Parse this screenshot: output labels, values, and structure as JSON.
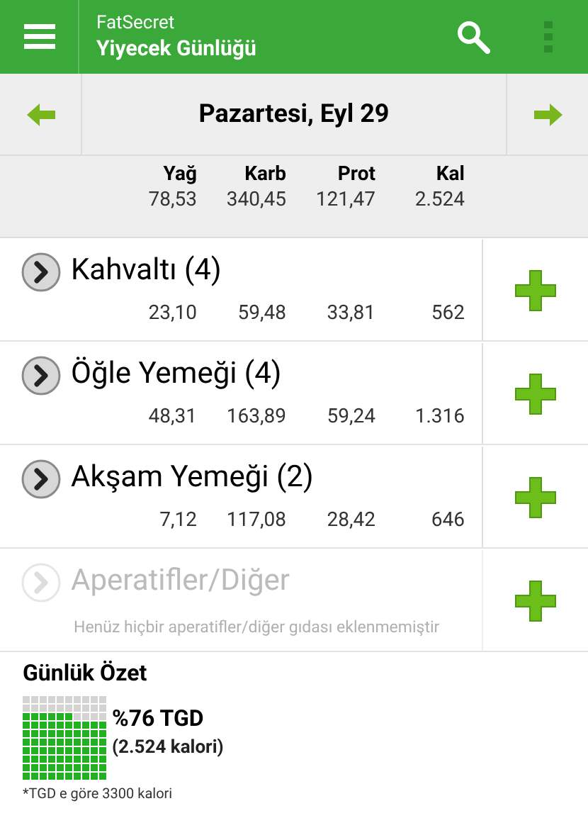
{
  "app_bar": {
    "app_name": "FatSecret",
    "title": "Yiyecek Günlüğü"
  },
  "date": "Pazartesi, Eyl 29",
  "totals": [
    {
      "label": "Yağ",
      "value": "78,53"
    },
    {
      "label": "Karb",
      "value": "340,45"
    },
    {
      "label": "Prot",
      "value": "121,47"
    },
    {
      "label": "Kal",
      "value": "2.524"
    }
  ],
  "meals": [
    {
      "name": "Kahvaltı (4)",
      "disabled": false,
      "values": [
        "23,10",
        "59,48",
        "33,81",
        "562"
      ]
    },
    {
      "name": "Öğle Yemeği (4)",
      "disabled": false,
      "values": [
        "48,31",
        "163,89",
        "59,24",
        "1.316"
      ]
    },
    {
      "name": "Akşam Yemeği (2)",
      "disabled": false,
      "values": [
        "7,12",
        "117,08",
        "28,42",
        "646"
      ]
    },
    {
      "name": "Aperatifler/Diğer",
      "disabled": true,
      "note": "Henüz hiçbir aperatifler/diğer gıdası eklenmemiştir"
    }
  ],
  "summary": {
    "title": "Günlük Özet",
    "percent": "%76 TGD",
    "calories": "(2.524 kalori)",
    "footnote": "*TGD e göre 3300 kalori"
  }
}
